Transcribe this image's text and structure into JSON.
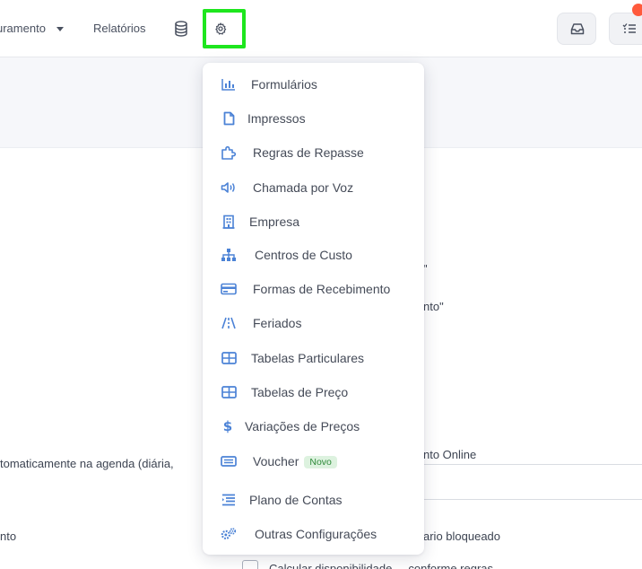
{
  "nav": {
    "faturamento": "uramento",
    "relatorios": "Relatórios",
    "database_icon": "database-icon",
    "settings_icon": "gear-icon",
    "inbox_icon": "inbox-icon",
    "tasks_icon": "checklist-icon"
  },
  "background": {
    "quote1": "\"",
    "quote2": "nto\"",
    "online": "nto Online",
    "auto": "tomaticamente na agenda (diária,",
    "ento": "nto",
    "bloqueado": "ario bloqueado",
    "cut": "Calcular disponibilidade ... conforme regras"
  },
  "menu": {
    "items": [
      {
        "label": "Formulários",
        "icon": "bar-chart-icon"
      },
      {
        "label": "Impressos",
        "icon": "file-icon"
      },
      {
        "label": "Regras de Repasse",
        "icon": "puzzle-icon"
      },
      {
        "label": "Chamada por Voz",
        "icon": "speaker-icon"
      },
      {
        "label": "Empresa",
        "icon": "building-icon"
      },
      {
        "label": "Centros de Custo",
        "icon": "sitemap-icon"
      },
      {
        "label": "Formas de Recebimento",
        "icon": "credit-card-icon"
      },
      {
        "label": "Feriados",
        "icon": "road-icon"
      },
      {
        "label": "Tabelas Particulares",
        "icon": "table-icon"
      },
      {
        "label": "Tabelas de Preço",
        "icon": "table-icon"
      },
      {
        "label": "Variações de Preços",
        "icon": "dollar-icon"
      },
      {
        "label": "Voucher",
        "icon": "voucher-icon",
        "badge": "Novo"
      },
      {
        "label": "Plano de Contas",
        "icon": "list-icon"
      },
      {
        "label": "Outras Configurações",
        "icon": "gears-icon"
      }
    ]
  },
  "colors": {
    "accent": "#4b82d6",
    "highlight": "#1ee61e",
    "badge_green_bg": "#ddf2df",
    "badge_green_text": "#2e8b3a"
  }
}
